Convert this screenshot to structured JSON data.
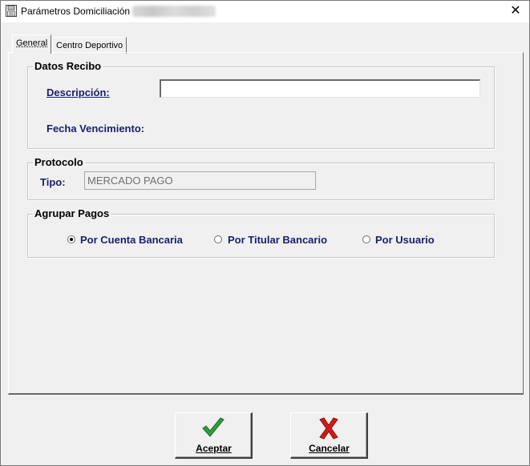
{
  "window": {
    "title": "Parámetros Domiciliación",
    "close_glyph": "✕",
    "icon": "floppy-disk-icon"
  },
  "tabs": [
    {
      "label": "General",
      "active": true
    },
    {
      "label": "Centro Deportivo",
      "active": false
    }
  ],
  "datos_recibo": {
    "title": "Datos Recibo",
    "descripcion_label": "Descripción:",
    "descripcion_value": "",
    "fecha_vencimiento_label": "Fecha Vencimiento:"
  },
  "protocolo": {
    "title": "Protocolo",
    "tipo_label": "Tipo:",
    "tipo_value": "MERCADO PAGO"
  },
  "agrupar_pagos": {
    "title": "Agrupar Pagos",
    "options": [
      {
        "label": "Por Cuenta Bancaria",
        "checked": true
      },
      {
        "label": "Por Titular Bancario",
        "checked": false
      },
      {
        "label": "Por Usuario",
        "checked": false
      }
    ]
  },
  "buttons": {
    "aceptar_label": "Aceptar",
    "aceptar_icon": "green-checkmark-icon",
    "cancelar_label": "Cancelar",
    "cancelar_icon": "red-x-icon"
  },
  "colors": {
    "label_blue": "#1a1e6e",
    "check_green": "#2e9e3a",
    "cancel_red": "#d11a1a"
  }
}
